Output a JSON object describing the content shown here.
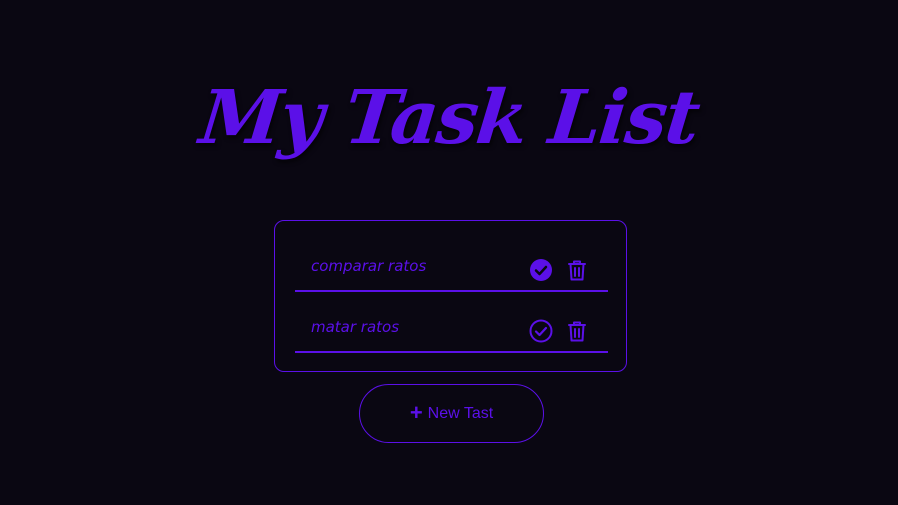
{
  "title": "My Task List",
  "colors": {
    "accent": "#5b10e8",
    "background": "#0a0712"
  },
  "tasks": [
    {
      "text": "comparar ratos",
      "completed": true
    },
    {
      "text": "matar ratos",
      "completed": false
    }
  ],
  "new_task": {
    "label": "New Tast",
    "icon": "plus-icon"
  },
  "icons": {
    "complete": "check-circle-icon",
    "delete": "trash-icon"
  }
}
